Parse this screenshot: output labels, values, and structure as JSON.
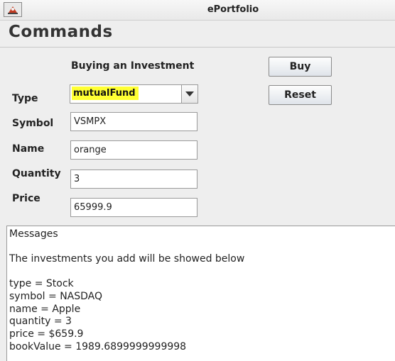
{
  "window": {
    "title": "ePortfolio"
  },
  "page": {
    "title": "Commands"
  },
  "form": {
    "heading": "Buying an Investment",
    "type_label": "Type",
    "type_value": "mutualFund",
    "symbol_label": "Symbol",
    "symbol_value": "VSMPX",
    "name_label": "Name",
    "name_value": "orange",
    "quantity_label": "Quantity",
    "quantity_value": "3",
    "price_label": "Price",
    "price_value": "65999.9"
  },
  "buttons": {
    "buy": "Buy",
    "reset": "Reset"
  },
  "messages": {
    "title": "Messages",
    "intro": "The investments you add will be showed below",
    "lines": [
      "type = Stock",
      "symbol = NASDAQ",
      "name = Apple",
      "quantity = 3",
      "price = $659.9",
      "bookValue = 1989.6899999999998"
    ]
  },
  "colors": {
    "highlight": "#ffff33"
  }
}
